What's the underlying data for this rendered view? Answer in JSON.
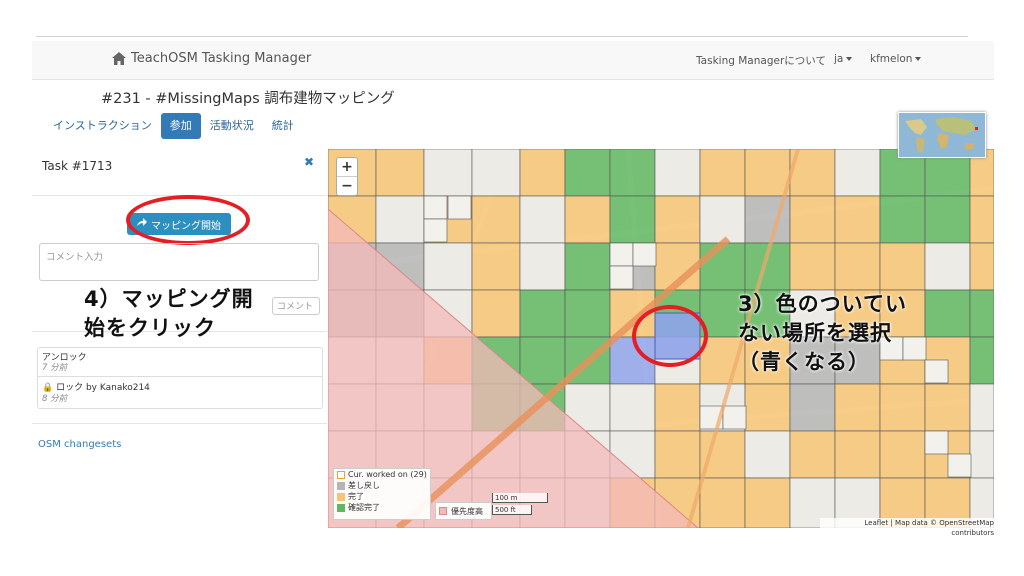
{
  "navbar": {
    "brand": "TeachOSM Tasking Manager",
    "about": "Tasking Managerについて",
    "lang": "ja",
    "user": "kfmelon"
  },
  "project": {
    "title": "#231 - #MissingMaps 調布建物マッピング"
  },
  "tabs": [
    {
      "label": "インストラクション"
    },
    {
      "label": "参加"
    },
    {
      "label": "活動状況"
    },
    {
      "label": "統計"
    }
  ],
  "task": {
    "header": "Task #1713",
    "start_button": "マッピング開始",
    "comment_placeholder": "コメント入力",
    "comment_button": "コメント",
    "history": [
      {
        "action": "アンロック",
        "time": "7 分前"
      },
      {
        "action": "ロック by Kanako214",
        "time": "8 分前"
      }
    ],
    "osm_link": "OSM changesets"
  },
  "annotations": {
    "step4_line1": "4）マッピング開",
    "step4_line2": "始をクリック",
    "step3_line1": "3）色のついてい",
    "step3_line2": "ない場所を選択",
    "step3_line3": "（青くなる）"
  },
  "map": {
    "zoom_in": "+",
    "zoom_out": "−",
    "legend": [
      {
        "label": "Cur. worked on (29)",
        "color": "#ffffff"
      },
      {
        "label": "差し戻し",
        "color": "#b5b5b5"
      },
      {
        "label": "完了",
        "color": "#f7c473"
      },
      {
        "label": "確認完了",
        "color": "#5fb760"
      }
    ],
    "priority_label": "優先度高",
    "scale_m": "100 m",
    "scale_ft": "500 ft",
    "attribution": "Leaflet | Map data © OpenStreetMap contributors",
    "colors": {
      "done": "#f7c473",
      "validated": "#5fb760",
      "invalidated": "#b5b5b5",
      "selected": "#8fa3ea",
      "priority": "#f4b9b9"
    }
  }
}
